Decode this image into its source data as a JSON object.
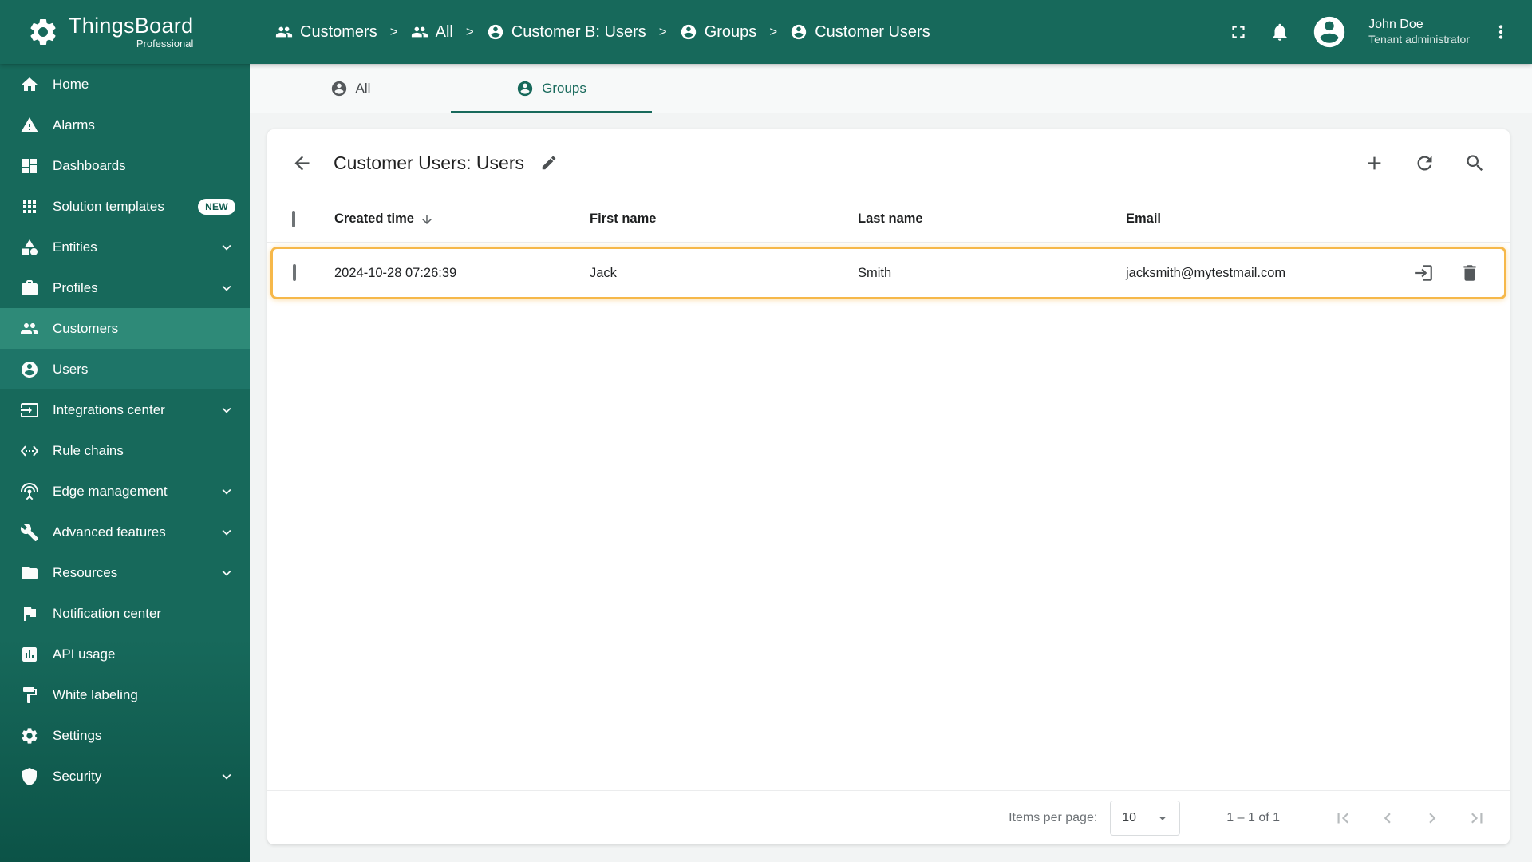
{
  "colors": {
    "primary": "#17695b",
    "sidebar-bottom": "#0c5347",
    "active": "#2e8a78",
    "active2": "#1e7568",
    "amber": "#f6b84a"
  },
  "brand": {
    "name": "ThingsBoard",
    "edition": "Professional"
  },
  "breadcrumb": {
    "separator": ">",
    "items": [
      {
        "label": "Customers",
        "icon": "customers-icon"
      },
      {
        "label": "All",
        "icon": "group-icon"
      },
      {
        "label": "Customer B: Users",
        "icon": "user-icon"
      },
      {
        "label": "Groups",
        "icon": "user-icon"
      },
      {
        "label": "Customer Users",
        "icon": "user-icon"
      }
    ]
  },
  "topbar": {
    "user_name": "John Doe",
    "user_role": "Tenant administrator"
  },
  "sidebar": {
    "items": [
      {
        "label": "Home",
        "icon": "home"
      },
      {
        "label": "Alarms",
        "icon": "warning"
      },
      {
        "label": "Dashboards",
        "icon": "dashboard"
      },
      {
        "label": "Solution templates",
        "icon": "apps",
        "badge": "NEW"
      },
      {
        "label": "Entities",
        "icon": "category"
      },
      {
        "label": "Profiles",
        "icon": "briefcase"
      },
      {
        "label": "Customers",
        "icon": "people"
      },
      {
        "label": "Users",
        "icon": "account-circle"
      },
      {
        "label": "Integrations center",
        "icon": "input"
      },
      {
        "label": "Rule chains",
        "icon": "settings-ethernet"
      },
      {
        "label": "Edge management",
        "icon": "antenna"
      },
      {
        "label": "Advanced features",
        "icon": "wrench"
      },
      {
        "label": "Resources",
        "icon": "folder"
      },
      {
        "label": "Notification center",
        "icon": "flag"
      },
      {
        "label": "API usage",
        "icon": "bar-chart"
      },
      {
        "label": "White labeling",
        "icon": "format-paint"
      },
      {
        "label": "Settings",
        "icon": "gear"
      },
      {
        "label": "Security",
        "icon": "shield"
      }
    ]
  },
  "tabs": {
    "all": "All",
    "groups": "Groups"
  },
  "panel": {
    "title": "Customer Users: Users",
    "columns": {
      "created": "Created time",
      "first": "First name",
      "last": "Last name",
      "email": "Email"
    },
    "rows": [
      {
        "created": "2024-10-28 07:26:39",
        "first": "Jack",
        "last": "Smith",
        "email": "jacksmith@mytestmail.com"
      }
    ],
    "pagination": {
      "items_per_page_label": "Items per page:",
      "per_page": "10",
      "range": "1 – 1 of 1"
    }
  }
}
